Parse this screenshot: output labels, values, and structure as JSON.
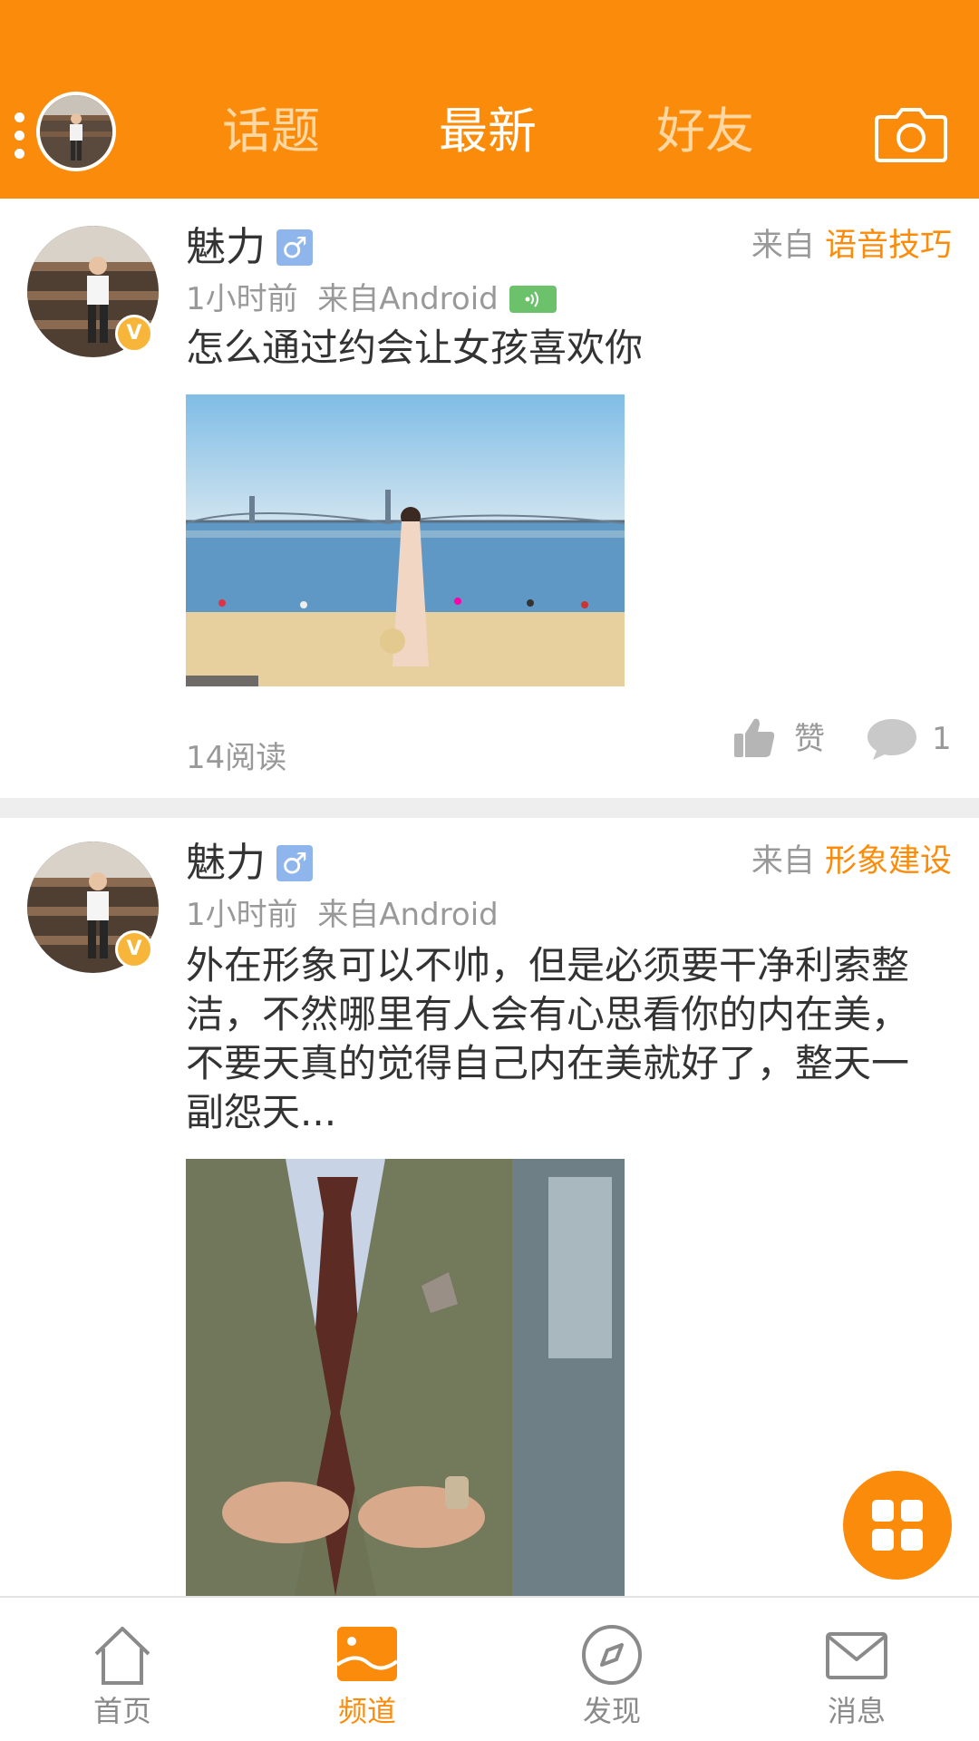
{
  "colors": {
    "brand": "#fb8c0b",
    "tab_inactive": "#ffd7a3",
    "muted": "#999999",
    "gender_badge": "#8fb6ec",
    "vip_badge": "#f7b53a",
    "voice_badge": "#6cc26b"
  },
  "header": {
    "tabs": [
      {
        "label": "话题",
        "active": false
      },
      {
        "label": "最新",
        "active": true
      },
      {
        "label": "好友",
        "active": false
      }
    ],
    "icons": [
      "menu-dots-icon",
      "avatar",
      "camera-icon"
    ]
  },
  "posts": [
    {
      "username": "魅力",
      "gender_symbol": "♂",
      "vip_badge": "V",
      "time": "1小时前",
      "client": "来自Android",
      "has_voice": true,
      "source_prefix": "来自",
      "category": "语音技巧",
      "text": "怎么通过约会让女孩喜欢你",
      "image": "beach-photo",
      "reads": "14阅读",
      "like_label": "赞",
      "comments": "1"
    },
    {
      "username": "魅力",
      "gender_symbol": "♂",
      "vip_badge": "V",
      "time": "1小时前",
      "client": "来自Android",
      "has_voice": false,
      "source_prefix": "来自",
      "category": "形象建设",
      "text": "外在形象可以不帅，但是必须要干净利索整洁，不然哪里有人会有心思看你的内在美，不要天真的觉得自己内在美就好了，整天一副怨天...",
      "image": "suit-photo"
    }
  ],
  "fab": {
    "icon": "grid-icon"
  },
  "bottom_nav": [
    {
      "label": "首页",
      "icon": "home-icon",
      "active": false
    },
    {
      "label": "频道",
      "icon": "channel-icon",
      "active": true
    },
    {
      "label": "发现",
      "icon": "compass-icon",
      "active": false
    },
    {
      "label": "消息",
      "icon": "mail-icon",
      "active": false
    }
  ]
}
